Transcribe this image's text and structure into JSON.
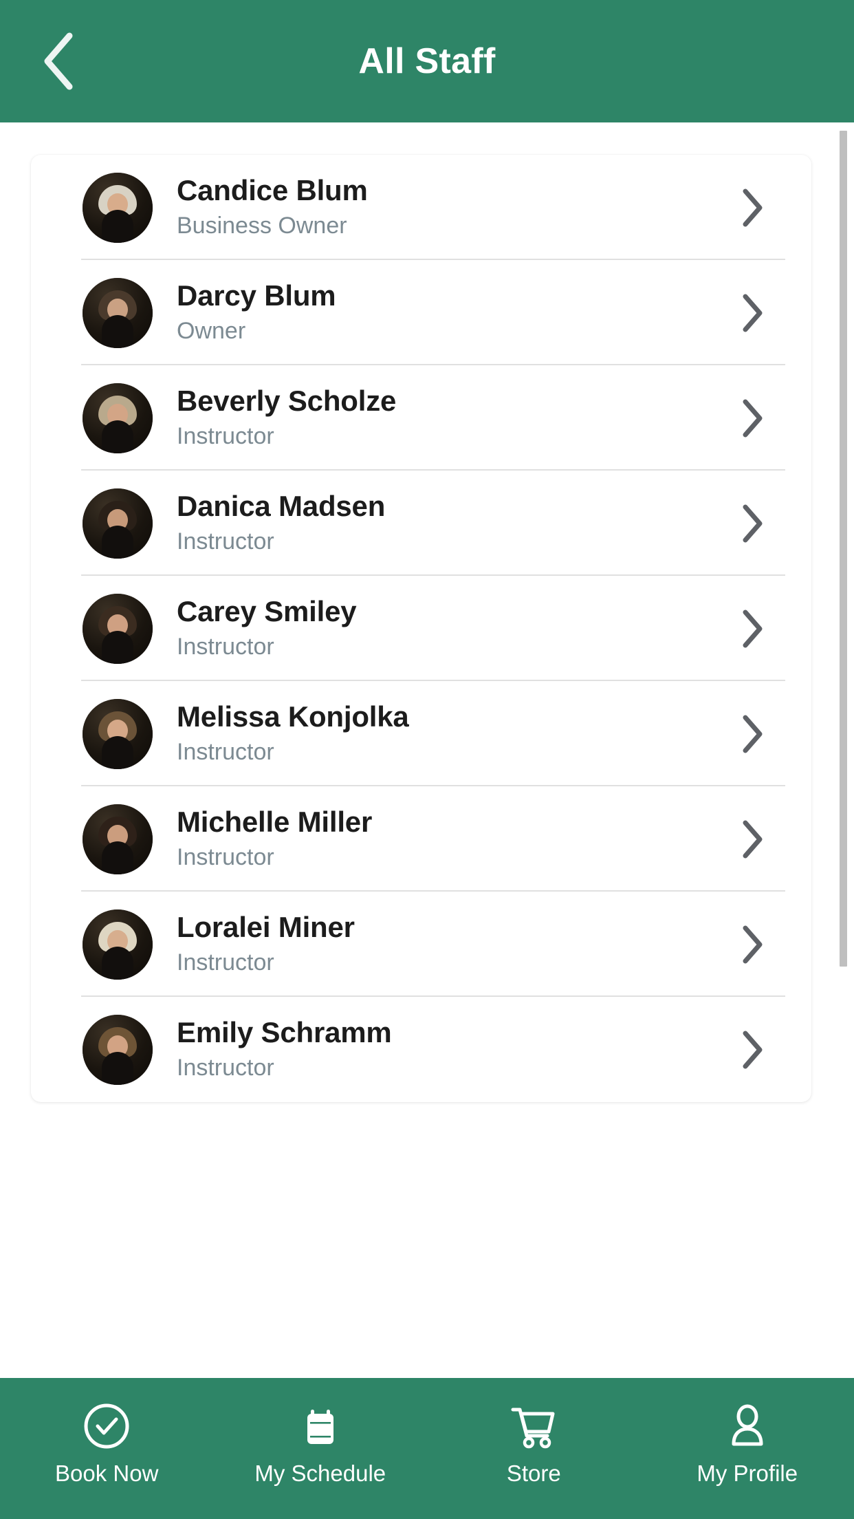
{
  "header": {
    "title": "All Staff",
    "back_icon": "chevron-left-icon",
    "background_color": "#2E8567",
    "text_color": "#FFFFFF"
  },
  "staff_list": {
    "row_chevron_icon": "chevron-right-icon",
    "name_color": "#1C1C1C",
    "role_color": "#7C8A92",
    "divider_color": "#E0E0E0",
    "items": [
      {
        "name": "Candice Blum",
        "role": "Business Owner",
        "avatar": "staff-photo-candice-blum",
        "hair": "#d8d2c4",
        "skin": "#d8ac8b"
      },
      {
        "name": "Darcy Blum",
        "role": "Owner",
        "avatar": "staff-photo-darcy-blum",
        "hair": "#4a3a2c",
        "skin": "#caa183"
      },
      {
        "name": "Beverly Scholze",
        "role": "Instructor",
        "avatar": "staff-photo-beverly-scholze",
        "hair": "#b9a98c",
        "skin": "#d3a586"
      },
      {
        "name": "Danica Madsen",
        "role": "Instructor",
        "avatar": "staff-photo-danica-madsen",
        "hair": "#2a2018",
        "skin": "#c79a7a"
      },
      {
        "name": "Carey Smiley",
        "role": "Instructor",
        "avatar": "staff-photo-carey-smiley",
        "hair": "#3b2c20",
        "skin": "#cfa082"
      },
      {
        "name": "Melissa Konjolka",
        "role": "Instructor",
        "avatar": "staff-photo-melissa-konjolka",
        "hair": "#6b5338",
        "skin": "#d5a888"
      },
      {
        "name": "Michelle Miller",
        "role": "Instructor",
        "avatar": "staff-photo-michelle-miller",
        "hair": "#2e2119",
        "skin": "#cb9d7e"
      },
      {
        "name": "Loralei Miner",
        "role": "Instructor",
        "avatar": "staff-photo-loralei-miner",
        "hair": "#ded6c2",
        "skin": "#d7ae8e"
      },
      {
        "name": "Emily Schramm",
        "role": "Instructor",
        "avatar": "staff-photo-emily-schramm",
        "hair": "#6e5436",
        "skin": "#d2a384"
      }
    ]
  },
  "scrollbar": {
    "visible": true,
    "thumb_color": "#BFBFBF"
  },
  "bottom_nav": {
    "background_color": "#2E8567",
    "text_color": "#FFFFFF",
    "items": [
      {
        "label": "Book Now",
        "icon": "check-circle-icon"
      },
      {
        "label": "My Schedule",
        "icon": "calendar-icon"
      },
      {
        "label": "Store",
        "icon": "shopping-cart-icon"
      },
      {
        "label": "My Profile",
        "icon": "person-icon"
      }
    ]
  }
}
